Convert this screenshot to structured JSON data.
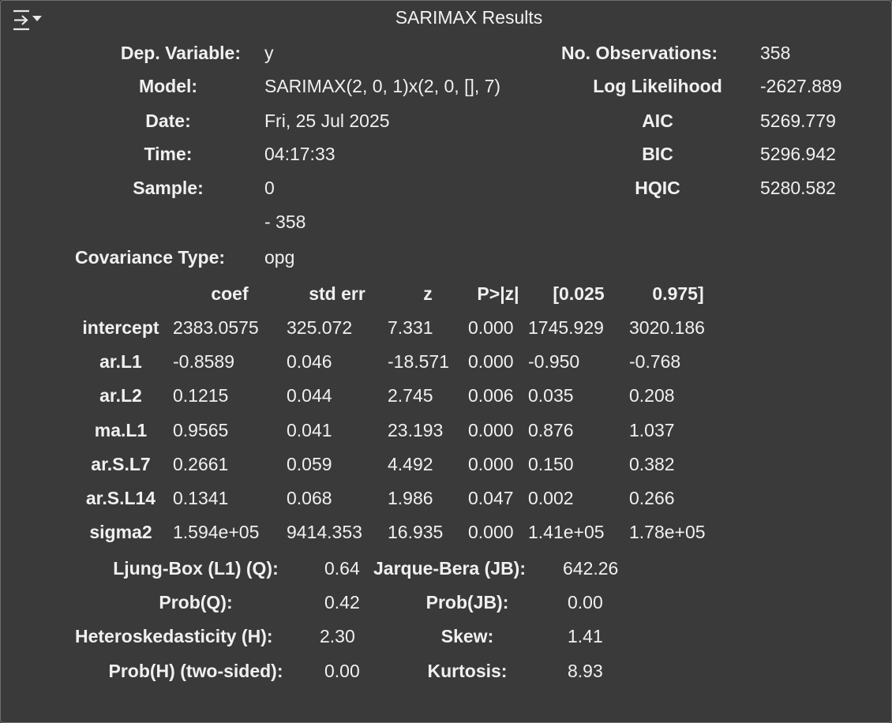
{
  "summary": {
    "title": "SARIMAX Results",
    "left_info": [
      {
        "label": "Dep. Variable:",
        "value": "y"
      },
      {
        "label": "Model:",
        "value": "SARIMAX(2, 0, 1)x(2, 0, [], 7)"
      },
      {
        "label": "Date:",
        "value": "Fri, 25 Jul 2025"
      },
      {
        "label": "Time:",
        "value": "04:17:33"
      },
      {
        "label": "Sample:",
        "value": "0"
      },
      {
        "label": "",
        "value": "- 358"
      },
      {
        "label": "Covariance Type:",
        "value": "opg"
      }
    ],
    "right_info": [
      {
        "label": "No. Observations:",
        "value": "358"
      },
      {
        "label": "Log Likelihood",
        "value": "-2627.889"
      },
      {
        "label": "AIC",
        "value": "5269.779"
      },
      {
        "label": "BIC",
        "value": "5296.942"
      },
      {
        "label": "HQIC",
        "value": "5280.582"
      }
    ]
  },
  "coef_table": {
    "headers": [
      "coef",
      "std err",
      "z",
      "P>|z|",
      "[0.025",
      "0.975]"
    ],
    "rows": [
      {
        "name": "intercept",
        "values": [
          "2383.0575",
          "325.072",
          "7.331",
          "0.000",
          "1745.929",
          "3020.186"
        ]
      },
      {
        "name": "ar.L1",
        "values": [
          "-0.8589",
          "0.046",
          "-18.571",
          "0.000",
          "-0.950",
          "-0.768"
        ]
      },
      {
        "name": "ar.L2",
        "values": [
          "0.1215",
          "0.044",
          "2.745",
          "0.006",
          "0.035",
          "0.208"
        ]
      },
      {
        "name": "ma.L1",
        "values": [
          "0.9565",
          "0.041",
          "23.193",
          "0.000",
          "0.876",
          "1.037"
        ]
      },
      {
        "name": "ar.S.L7",
        "values": [
          "0.2661",
          "0.059",
          "4.492",
          "0.000",
          "0.150",
          "0.382"
        ]
      },
      {
        "name": "ar.S.L14",
        "values": [
          "0.1341",
          "0.068",
          "1.986",
          "0.047",
          "0.002",
          "0.266"
        ]
      },
      {
        "name": "sigma2",
        "values": [
          "1.594e+05",
          "9414.353",
          "16.935",
          "0.000",
          "1.41e+05",
          "1.78e+05"
        ]
      }
    ]
  },
  "diagnostics": {
    "rows": [
      {
        "left_label": "Ljung-Box (L1) (Q):",
        "left_value": "0.64",
        "right_label": "Jarque-Bera (JB):",
        "right_value": "642.26"
      },
      {
        "left_label": "Prob(Q):",
        "left_value": "0.42",
        "right_label": "Prob(JB):",
        "right_value": "0.00"
      },
      {
        "left_label": "Heteroskedasticity (H):",
        "left_value": "2.30",
        "right_label": "Skew:",
        "right_value": "1.41"
      },
      {
        "left_label": "Prob(H) (two-sided):",
        "left_value": "0.00",
        "right_label": "Kurtosis:",
        "right_value": "8.93"
      }
    ]
  },
  "icons": {
    "output_toggle": "output-collapse-icon"
  }
}
